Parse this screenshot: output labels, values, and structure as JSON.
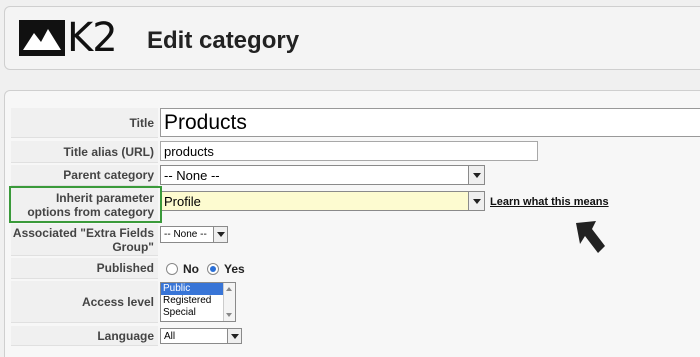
{
  "header": {
    "logo_text": "K2",
    "title": "Edit category"
  },
  "form": {
    "title": {
      "label": "Title",
      "value": "Products"
    },
    "alias": {
      "label": "Title alias (URL)",
      "value": "products"
    },
    "parent": {
      "label": "Parent category",
      "value": "-- None --"
    },
    "inherit": {
      "label_line1": "Inherit parameter",
      "label_line2": "options from category",
      "value": "Profile",
      "help_link": "Learn what this means"
    },
    "extra_fields": {
      "label_line1": "Associated \"Extra Fields",
      "label_line2": "Group\"",
      "value": "-- None --"
    },
    "published": {
      "label": "Published",
      "options": [
        "No",
        "Yes"
      ],
      "selected": "Yes"
    },
    "access": {
      "label": "Access level",
      "options": [
        "Public",
        "Registered",
        "Special"
      ],
      "selected": "Public"
    },
    "language": {
      "label": "Language",
      "value": "All"
    }
  },
  "colors": {
    "highlight_field": "#fdfbd0",
    "annotation_box": "#3a9a3a",
    "selection": "#3875d7"
  },
  "icons": {
    "annotation_arrow": "arrow-icon",
    "logo": "mountain-logo-icon"
  }
}
